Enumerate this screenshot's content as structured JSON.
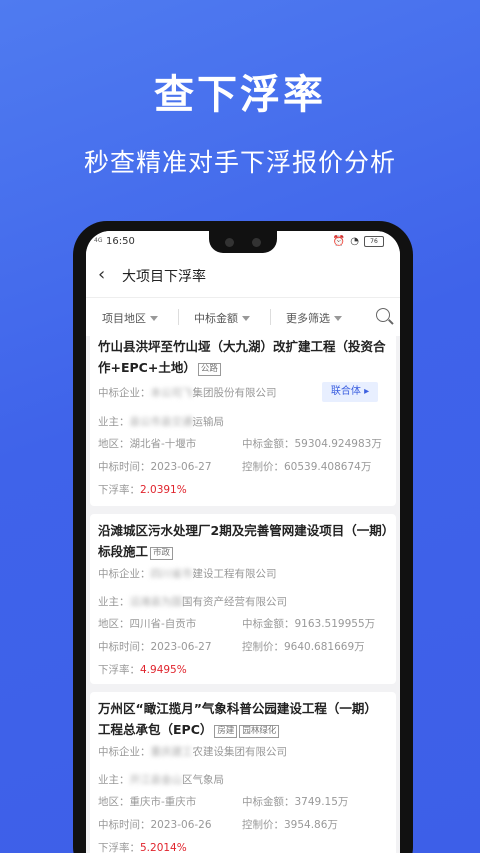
{
  "headline": "查下浮率",
  "subline": "秒查精准对手下浮报价分析",
  "status": {
    "time": "16:50",
    "battery": "76",
    "signal": "4G"
  },
  "nav": {
    "title": "大项目下浮率"
  },
  "filters": [
    "项目地区",
    "中标金额",
    "更多筛选"
  ],
  "labels": {
    "winner": "中标企业：",
    "owner": "业主：",
    "region": "地区：",
    "amount": "中标金额：",
    "date": "中标时间：",
    "control": "控制价：",
    "rate": "下浮率："
  },
  "consortium_label": "联合体 ▸",
  "cards": [
    {
      "title": "竹山县洪坪至竹山垭（大九湖）改扩建工程（投资合作+EPC+土地）",
      "tags": [
        "公路"
      ],
      "winner_blur": "本公司飞",
      "winner_text": "集团股份有限公司",
      "owner_blur": "县公市县交通",
      "owner_text": "运输局",
      "region": "湖北省-十堰市",
      "amount": "59304.924983万",
      "date": "2023-06-27",
      "control": "60539.408674万",
      "rate": "2.0391%"
    },
    {
      "title": "沿滩城区污水处理厂2期及完善管网建设项目（一期）标段施工",
      "tags": [
        "市政"
      ],
      "winner_blur": "四川省市",
      "winner_text": "建设工程有限公司",
      "owner_blur": "沿滩县为国",
      "owner_text": "国有资产经营有限公司",
      "region": "四川省-自贡市",
      "amount": "9163.519955万",
      "date": "2023-06-27",
      "control": "9640.681669万",
      "rate": "4.9495%"
    },
    {
      "title": "万州区“瞰江揽月”气象科普公园建设工程（一期）工程总承包（EPC）",
      "tags": [
        "房建",
        "园林绿化"
      ],
      "winner_blur": "重庆建工",
      "winner_text": "农建设集团有限公司",
      "owner_blur": "开江县金山",
      "owner_text": "区气象局",
      "region": "重庆市-重庆市",
      "amount": "3749.15万",
      "date": "2023-06-26",
      "control": "3954.86万",
      "rate": "5.2014%"
    }
  ]
}
